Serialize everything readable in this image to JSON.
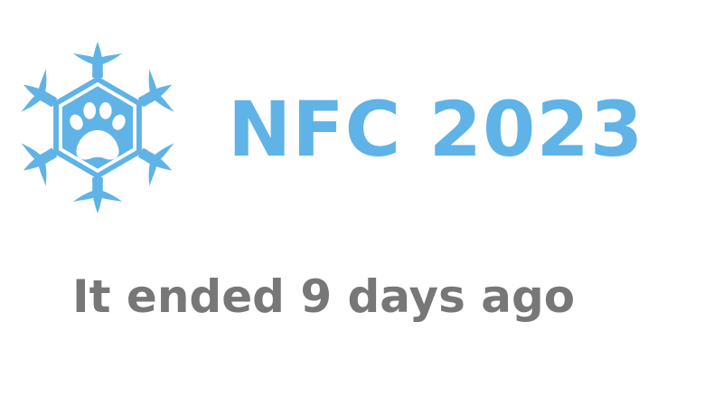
{
  "logo": {
    "icon": "snowflake-paw-icon",
    "color": "#5fb3e6"
  },
  "event": {
    "title": "NFC 2023",
    "title_color": "#5fb3e6"
  },
  "status": {
    "text": "It ended 9 days ago",
    "text_color": "#777777"
  }
}
